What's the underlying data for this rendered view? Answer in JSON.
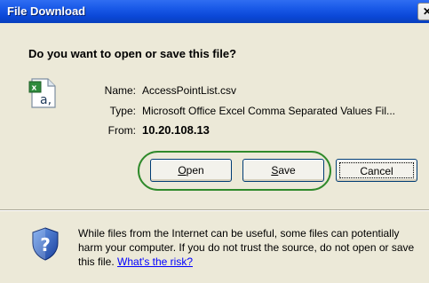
{
  "window": {
    "title": "File Download",
    "close_glyph": "✕"
  },
  "dialog": {
    "question": "Do you want to open or save this file?",
    "file_icon": "excel-csv-file-icon",
    "fields": [
      {
        "label": "Name:",
        "value": "AccessPointList.csv"
      },
      {
        "label": "Type:",
        "value": "Microsoft Office Excel Comma Separated Values Fil..."
      },
      {
        "label": "From:",
        "value": "10.20.108.13"
      }
    ]
  },
  "buttons": {
    "open": {
      "mnemonic": "O",
      "rest": "pen"
    },
    "save": {
      "mnemonic": "S",
      "rest": "ave"
    },
    "cancel": {
      "label": "Cancel"
    }
  },
  "warning": {
    "icon": "security-shield-question-icon",
    "text": "While files from the Internet can be useful, some files can potentially harm your computer. If you do not trust the source, do not open or save this file.",
    "link": "What's the risk?"
  },
  "colors": {
    "title_bar": "#0b48d8",
    "dialog_bg": "#ece9d8",
    "highlight": "#2f8a2b",
    "link": "#0000ff"
  }
}
